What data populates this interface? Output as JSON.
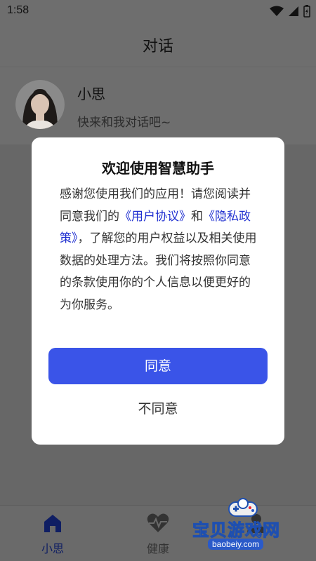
{
  "status_bar": {
    "time": "1:58"
  },
  "header": {
    "title": "对话"
  },
  "contact": {
    "name": "小思",
    "preview": "快来和我对话吧~"
  },
  "dialog": {
    "title": "欢迎使用智慧助手",
    "body_1": "感谢您使用我们的应用！请您阅读并同意我们的",
    "link_1": "《用户协议》",
    "body_2": "和",
    "link_2": "《隐私政策》",
    "body_3": "，了解您的用户权益以及相关使用数据的处理方法。我们将按照你同意的条款使用你的个人信息以便更好的为你服务。",
    "agree_label": "同意",
    "disagree_label": "不同意"
  },
  "bottom_nav": {
    "items": [
      {
        "label": "小思",
        "icon": "home-icon",
        "active": true
      },
      {
        "label": "健康",
        "icon": "heart-pulse-icon",
        "active": false
      },
      {
        "label": "",
        "icon": "person-icon",
        "active": false
      }
    ]
  },
  "watermark": {
    "text": "宝贝游戏网",
    "url": "baobeiy.com"
  }
}
